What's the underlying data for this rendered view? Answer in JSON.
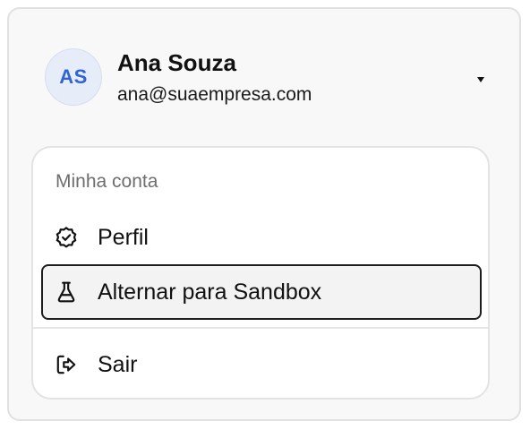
{
  "user": {
    "initials": "AS",
    "name": "Ana Souza",
    "email": "ana@suaempresa.com"
  },
  "menu": {
    "section_label": "Minha conta",
    "items": [
      {
        "label": "Perfil",
        "icon": "badge-check-icon"
      },
      {
        "label": "Alternar para Sandbox",
        "icon": "flask-icon",
        "highlighted": true
      },
      {
        "label": "Sair",
        "icon": "logout-icon"
      }
    ]
  },
  "colors": {
    "avatar_background": "#e6ecf8",
    "avatar_text": "#2f64d6",
    "card_background": "#f8f8f8",
    "highlight_border": "#1d1d1d"
  }
}
